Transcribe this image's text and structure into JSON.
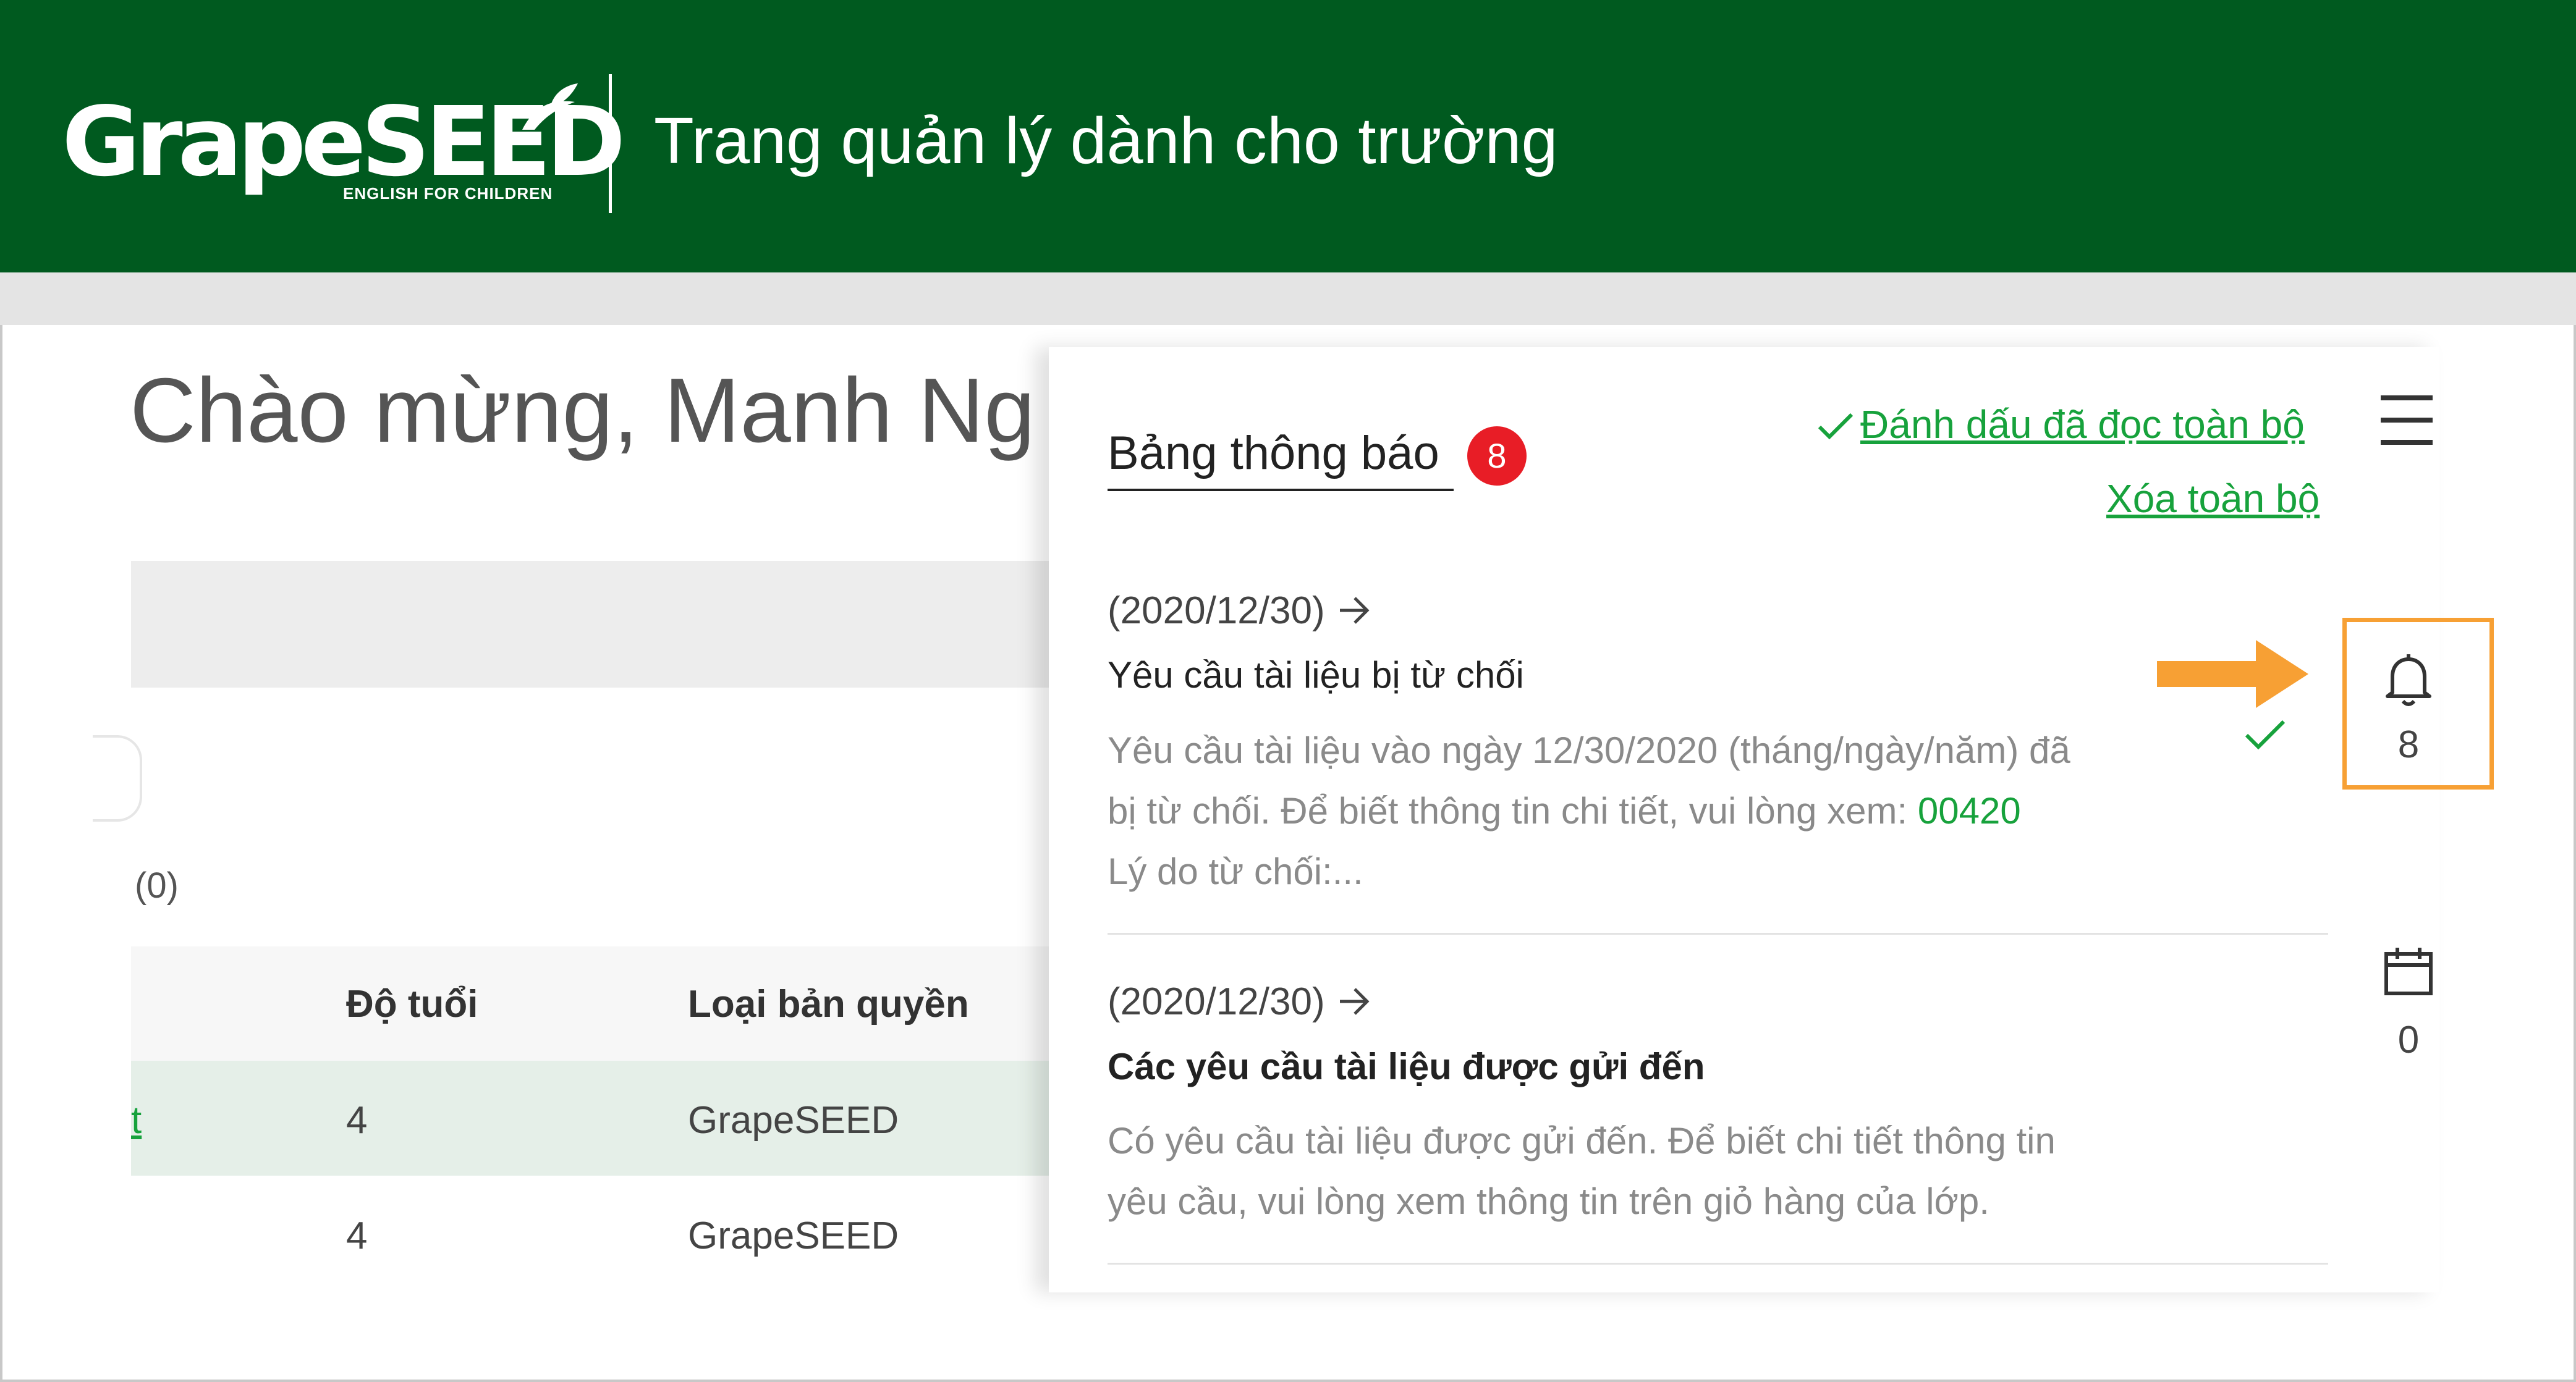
{
  "header": {
    "logo_text": "GrapeSEED",
    "logo_tagline": "ENGLISH FOR CHILDREN",
    "app_title": "Trang quản lý dành cho trường"
  },
  "background_page": {
    "welcome": "Chào mừng, Manh Ng",
    "count_label": "(0)",
    "table": {
      "headers": [
        "Độ tuổi",
        "Loại bản quyền"
      ],
      "rows": [
        {
          "link": "t",
          "age": "4",
          "license": "GrapeSEED"
        },
        {
          "link": "",
          "age": "4",
          "license": "GrapeSEED"
        }
      ]
    }
  },
  "panel": {
    "title": "Bảng thông báo",
    "badge_count": "8",
    "mark_all_read": "Đánh dấu đã đọc toàn bộ",
    "clear_all": "Xóa toàn bộ",
    "notifications": [
      {
        "date": "(2020/12/30)",
        "title": "Yêu cầu tài liệu bị từ chối",
        "body_line1": "Yêu cầu tài liệu vào ngày 12/30/2020 (tháng/ngày/năm) đã",
        "body_line2": "bị từ chối. Để biết thông tin chi tiết, vui lòng xem:",
        "code": "00420",
        "body_line3": "Lý do từ chối:..."
      },
      {
        "date": "(2020/12/30)",
        "title": "Các yêu cầu tài liệu được gửi đến",
        "body_line1": "Có yêu cầu tài liệu được gửi đến. Để biết chi tiết thông tin",
        "body_line2": "yêu cầu, vui lòng xem thông tin trên giỏ hàng của lớp."
      }
    ]
  },
  "side": {
    "notifications_count": "8",
    "calendar_count": "0"
  },
  "colors": {
    "header_green": "#005a1f",
    "link_green": "#17a23c",
    "badge_red": "#e81d26",
    "highlight_orange": "#f7a034"
  }
}
